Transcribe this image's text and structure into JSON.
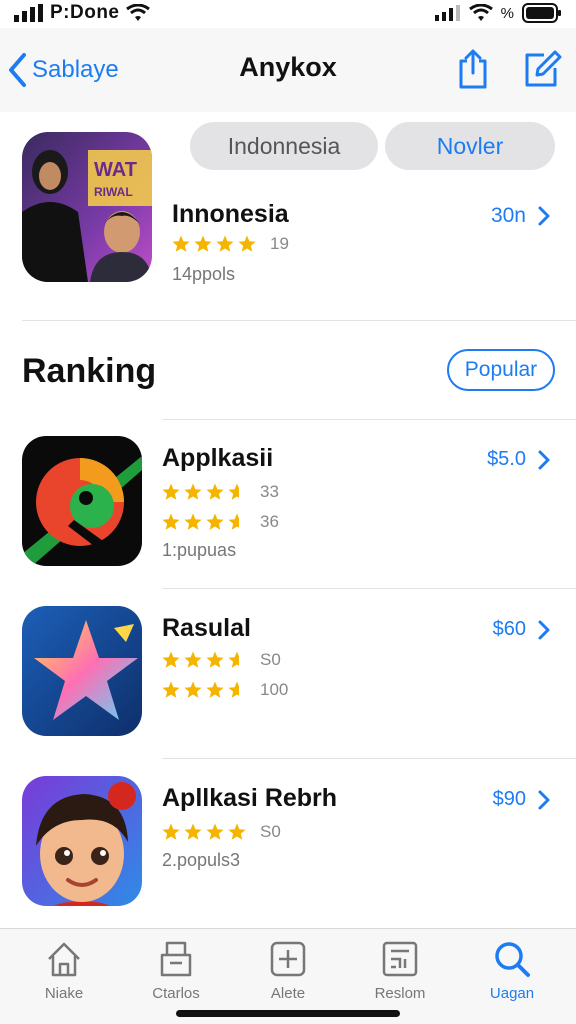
{
  "status_bar": {
    "time": "P:Done",
    "battery_text": "%"
  },
  "nav": {
    "back_label": "Sablaye",
    "title": "Anykox"
  },
  "filters": {
    "pill_a": "Indonnesia",
    "pill_b": "Novler"
  },
  "featured": {
    "name": "Innonesia",
    "rating": 4,
    "rating_count": "19",
    "subtitle": "14ppols",
    "price": "30n"
  },
  "section": {
    "title": "Ranking",
    "filter_label": "Popular"
  },
  "apps": [
    {
      "name": "Applkasii",
      "rating": 3.5,
      "rating_count": "33",
      "rating2": 3.5,
      "rating2_count": "36",
      "subtitle": "1:pupuas",
      "price": "$5.0"
    },
    {
      "name": "Rasulal",
      "rating": 3.5,
      "rating_count": "S0",
      "rating2": 3.5,
      "rating2_count": "100",
      "subtitle": "",
      "price": "$60"
    },
    {
      "name": "Apllkasi Rebrh",
      "rating": 4,
      "rating_count": "S0",
      "subtitle": "2.populs3",
      "price": "$90"
    }
  ],
  "tabs": [
    {
      "label": "Niake",
      "icon": "home-icon"
    },
    {
      "label": "Ctarlos",
      "icon": "archive-icon"
    },
    {
      "label": "Alete",
      "icon": "plus-square-icon"
    },
    {
      "label": "Reslom",
      "icon": "grid-icon"
    },
    {
      "label": "Uagan",
      "icon": "search-icon"
    }
  ],
  "colors": {
    "accent": "#1e7cf2",
    "star": "#f5b400"
  }
}
